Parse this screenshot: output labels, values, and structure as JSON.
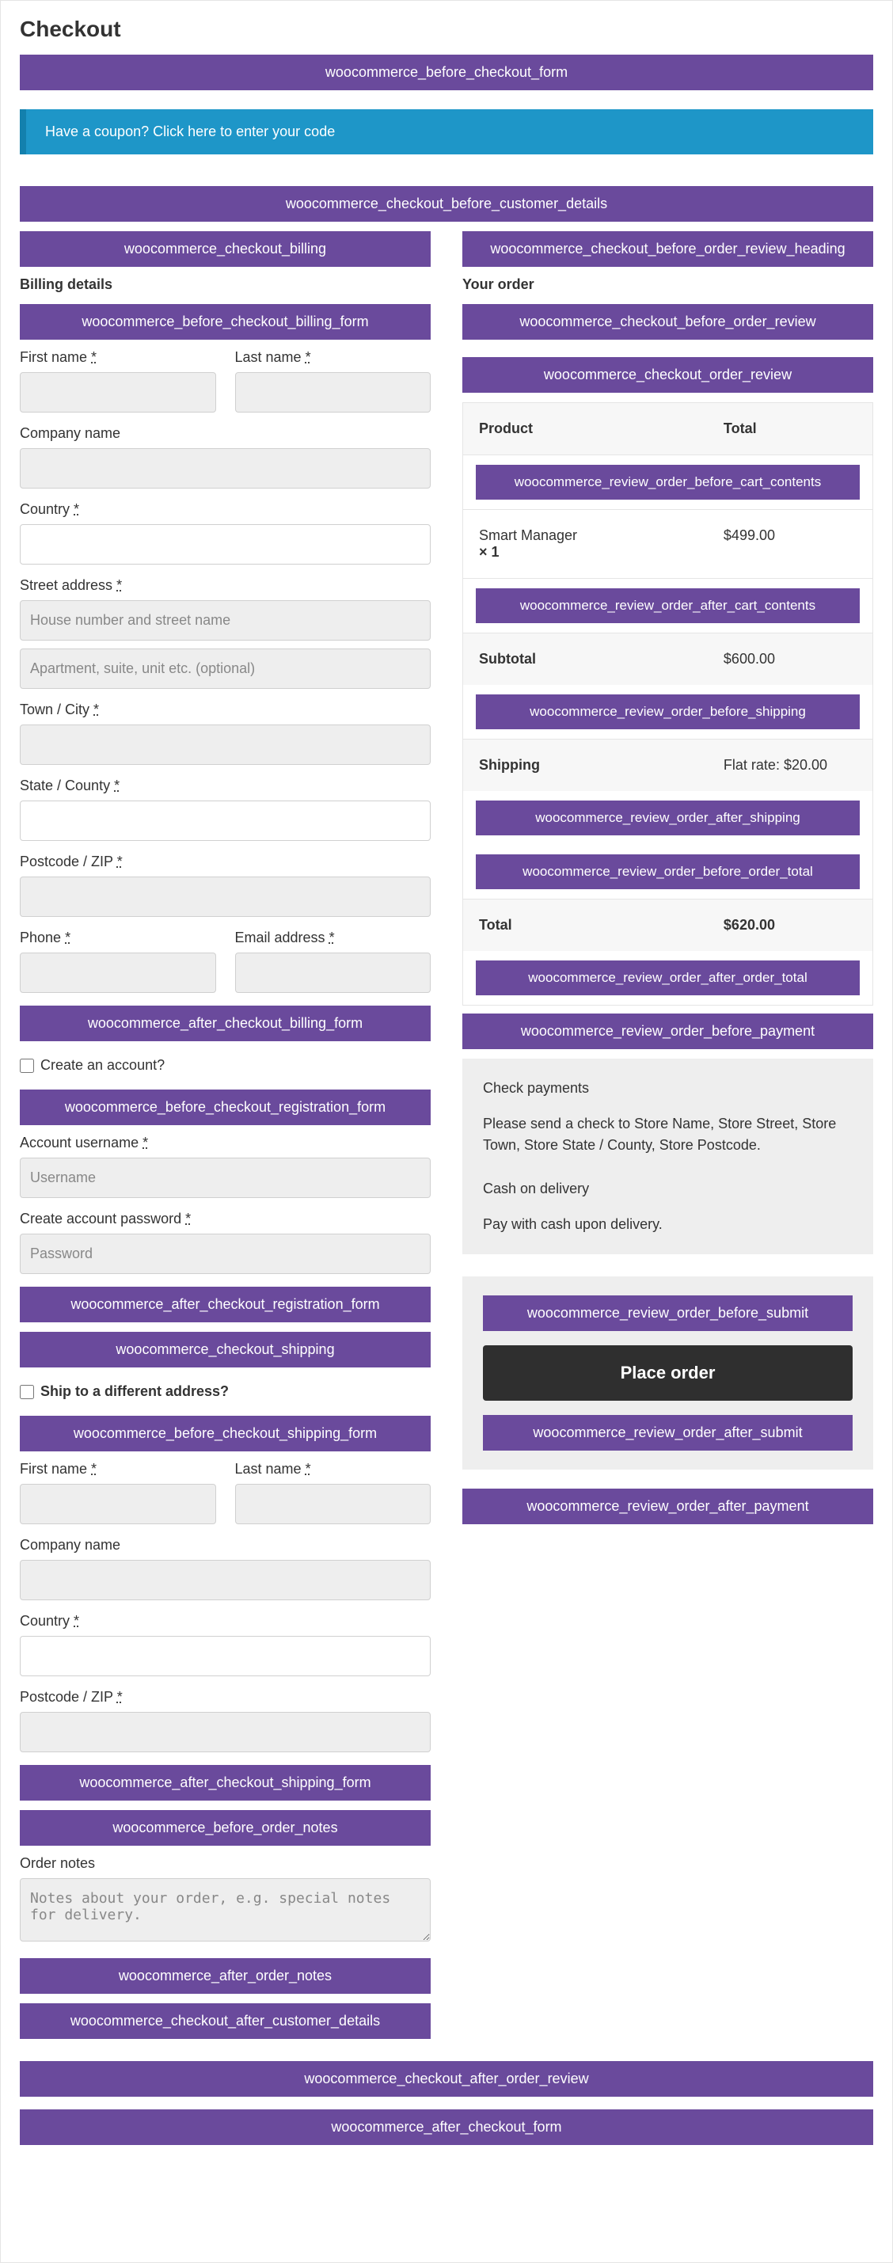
{
  "page_title": "Checkout",
  "hooks": {
    "before_form": "woocommerce_before_checkout_form",
    "before_customer_details": "woocommerce_checkout_before_customer_details",
    "checkout_billing": "woocommerce_checkout_billing",
    "before_billing_form": "woocommerce_before_checkout_billing_form",
    "after_billing_form": "woocommerce_after_checkout_billing_form",
    "before_registration_form": "woocommerce_before_checkout_registration_form",
    "after_registration_form": "woocommerce_after_checkout_registration_form",
    "checkout_shipping": "woocommerce_checkout_shipping",
    "before_shipping_form": "woocommerce_before_checkout_shipping_form",
    "after_shipping_form": "woocommerce_after_checkout_shipping_form",
    "before_order_notes": "woocommerce_before_order_notes",
    "after_order_notes": "woocommerce_after_order_notes",
    "after_customer_details": "woocommerce_checkout_after_customer_details",
    "before_order_review_heading": "woocommerce_checkout_before_order_review_heading",
    "before_order_review": "woocommerce_checkout_before_order_review",
    "checkout_order_review": "woocommerce_checkout_order_review",
    "review_before_cart": "woocommerce_review_order_before_cart_contents",
    "review_after_cart": "woocommerce_review_order_after_cart_contents",
    "review_before_shipping": "woocommerce_review_order_before_shipping",
    "review_after_shipping": "woocommerce_review_order_after_shipping",
    "review_before_order_total": "woocommerce_review_order_before_order_total",
    "review_after_order_total": "woocommerce_review_order_after_order_total",
    "review_before_payment": "woocommerce_review_order_before_payment",
    "review_before_submit": "woocommerce_review_order_before_submit",
    "review_after_submit": "woocommerce_review_order_after_submit",
    "review_after_payment": "woocommerce_review_order_after_payment",
    "after_order_review": "woocommerce_checkout_after_order_review",
    "after_form": "woocommerce_after_checkout_form"
  },
  "coupon_notice": "Have a coupon? Click here to enter your code",
  "billing": {
    "heading": "Billing details",
    "first_name": "First name ",
    "last_name": "Last name ",
    "company": "Company name",
    "country": "Country ",
    "street": "Street address ",
    "street_ph": "House number and street name",
    "street2_ph": "Apartment, suite, unit etc. (optional)",
    "town": "Town / City ",
    "state": "State / County ",
    "postcode": "Postcode / ZIP ",
    "phone": "Phone ",
    "email": "Email address ",
    "create_account": "Create an account?",
    "acct_user": "Account username ",
    "acct_user_ph": "Username",
    "acct_pass": "Create account password ",
    "acct_pass_ph": "Password"
  },
  "shipping": {
    "ship_diff": "Ship to a different address?",
    "first_name": "First name ",
    "last_name": "Last name ",
    "company": "Company name",
    "country": "Country ",
    "postcode": "Postcode / ZIP ",
    "notes_label": "Order notes",
    "notes_ph": "Notes about your order, e.g. special notes for delivery."
  },
  "order": {
    "heading": "Your order",
    "col_product": "Product",
    "col_total": "Total",
    "item_name": "Smart Manager",
    "item_qty": "× 1",
    "item_total": "$499.00",
    "subtotal_label": "Subtotal",
    "subtotal_value": "$600.00",
    "shipping_label": "Shipping",
    "shipping_value": "Flat rate: $20.00",
    "total_label": "Total",
    "total_value": "$620.00"
  },
  "payment": {
    "check_title": "Check payments",
    "check_text": "Please send a check to Store Name, Store Street, Store Town, Store State / County, Store Postcode.",
    "cod_title": "Cash on delivery",
    "cod_text": "Pay with cash upon delivery.",
    "place_order": "Place order"
  },
  "asterisk": "*"
}
